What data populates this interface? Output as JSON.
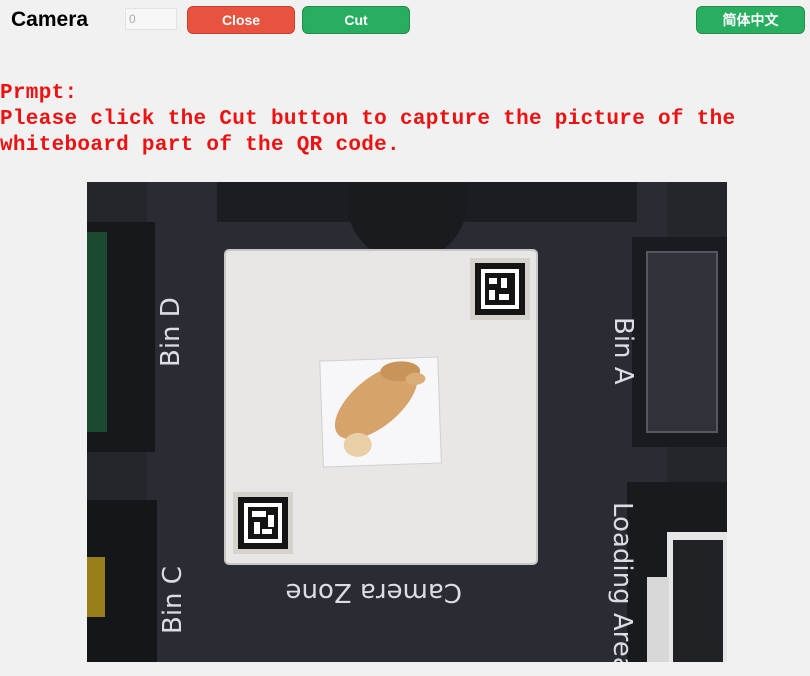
{
  "header": {
    "title": "Camera",
    "count_value": "0",
    "close_label": "Close",
    "cut_label": "Cut",
    "language_label": "简体中文"
  },
  "prompt": {
    "heading": "Prmpt:",
    "line1": "Please click the Cut button to capture the picture of the",
    "line2": "whiteboard part of the QR code."
  },
  "camera_feed": {
    "bin_d": "Bin D",
    "bin_a": "Bin A",
    "bin_c": "Bin C",
    "camera_zone": "Camera Zone",
    "loading_area": "Loading Area"
  }
}
